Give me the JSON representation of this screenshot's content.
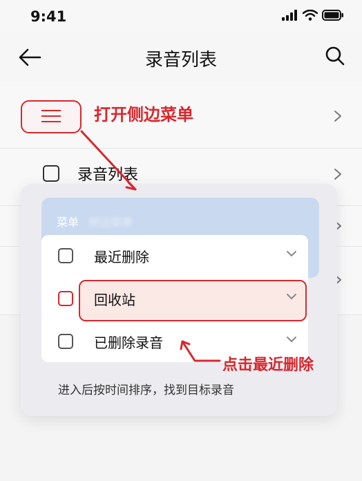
{
  "status_bar": {
    "time": "9:41"
  },
  "nav": {
    "title": "录音列表"
  },
  "rows": {
    "row2_label": "录音列表"
  },
  "annotations": {
    "open_sidebar": "打开侧边菜单",
    "click_recent_delete": "点击最近删除"
  },
  "card": {
    "header_label": "菜单",
    "header_blurred": "侧边菜单",
    "items": [
      {
        "label": "最近删除"
      },
      {
        "label": "回收站"
      },
      {
        "label": "已删除录音"
      }
    ],
    "footer_text": "进入后按时间排序，找到目标录音"
  },
  "colors": {
    "accent_red": "#d9262c",
    "header_blue": "#c9d9f0"
  }
}
